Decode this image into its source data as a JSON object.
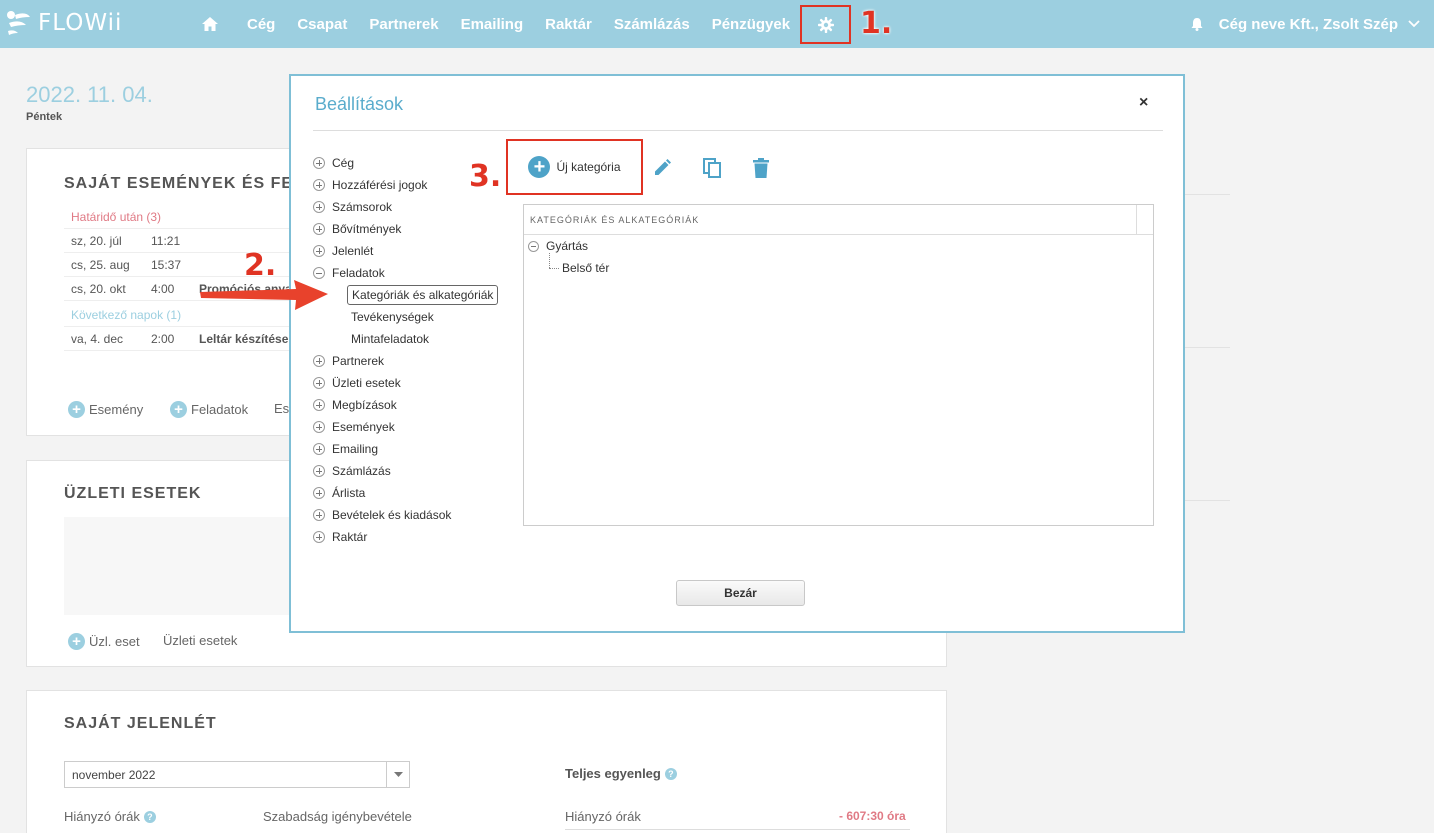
{
  "app": {
    "name": "FLOWii"
  },
  "nav": {
    "items": [
      "Cég",
      "Csapat",
      "Partnerek",
      "Emailing",
      "Raktár",
      "Számlázás",
      "Pénzügyek"
    ],
    "user": "Cég neve Kft., Zsolt Szép"
  },
  "annotations": {
    "step1": "1.",
    "step2": "2.",
    "step3": "3."
  },
  "page": {
    "date": "2022. 11. 04.",
    "weekday": "Péntek",
    "events_panel": {
      "title": "SAJÁT ESEMÉNYEK ÉS FELA",
      "group_overdue": "Határidő után (3)",
      "rows_overdue": [
        {
          "date": "sz, 20. júl",
          "time": "11:21",
          "text": ""
        },
        {
          "date": "cs, 25. aug",
          "time": "15:37",
          "text": ""
        },
        {
          "date": "cs, 20. okt",
          "time": "4:00",
          "text": "Promóciós anya"
        }
      ],
      "group_next": "Következő napok (1)",
      "rows_next": [
        {
          "date": "va, 4. dec",
          "time": "2:00",
          "text": "Leltár készítése"
        }
      ],
      "add_event": "Esemény",
      "add_task": "Feladatok",
      "add_more": "Es"
    },
    "deals_panel": {
      "title": "ÜZLETI ESETEK",
      "add_deal": "Üzl. eset",
      "deals_link": "Üzleti esetek"
    },
    "attendance_panel": {
      "title": "SAJÁT JELENLÉT",
      "month_value": "november 2022",
      "missing_hours_label": "Hiányzó órák",
      "leave_label": "Szabadság igénybevétele",
      "total_balance_label": "Teljes egyenleg",
      "missing_hours_right_label": "Hiányzó órák",
      "missing_hours_value": "- 607:30 óra"
    }
  },
  "modal": {
    "title": "Beállítások",
    "close_x": "×",
    "tree": [
      "Cég",
      "Hozzáférési jogok",
      "Számsorok",
      "Bővítmények",
      "Jelenlét",
      "Feladatok"
    ],
    "tree_sub": [
      "Kategóriák és alkategóriák",
      "Tevékenységek",
      "Mintafeladatok"
    ],
    "tree_after": [
      "Partnerek",
      "Üzleti esetek",
      "Megbízások",
      "Események",
      "Emailing",
      "Számlázás",
      "Árlista",
      "Bevételek és kiadások",
      "Raktár"
    ],
    "new_category": "Új kategória",
    "grid_header": "KATEGÓRIÁK ÉS ALKATEGÓRIÁK",
    "grid_root": "Gyártás",
    "grid_child": "Belső tér",
    "close_button": "Bezár"
  },
  "colors": {
    "topbar": "#9ccfe0",
    "accent": "#4ea3c8",
    "annotation": "#e03323"
  }
}
